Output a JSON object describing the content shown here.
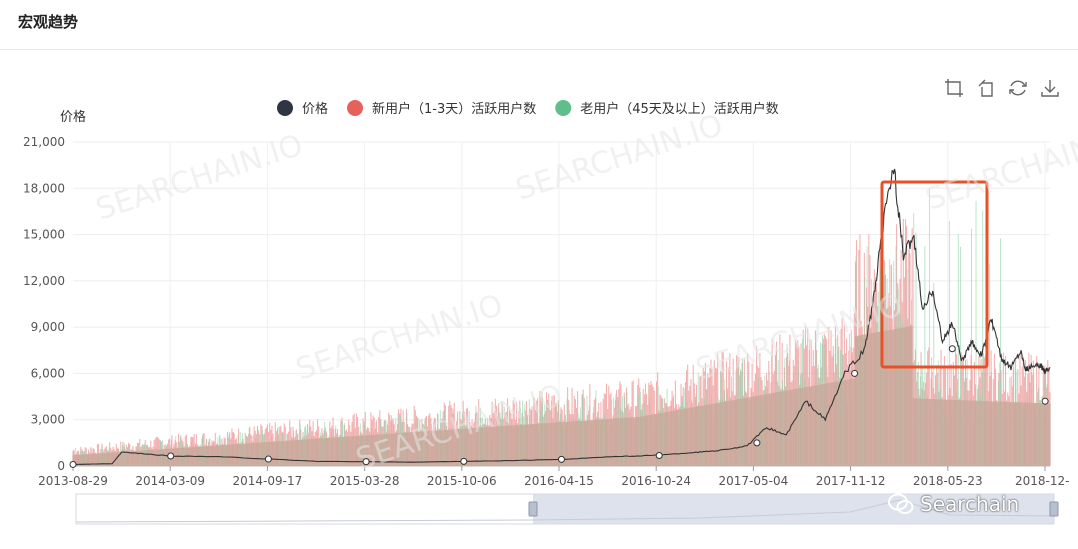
{
  "header": {
    "title": "宏观趋势"
  },
  "toolbar": {
    "buttons": [
      {
        "icon": "zoom-icon"
      },
      {
        "icon": "zoom-reset-icon"
      },
      {
        "icon": "refresh-icon"
      },
      {
        "icon": "download-icon"
      }
    ]
  },
  "brand_watermark": {
    "text": "Searchain"
  },
  "chart_data": {
    "type": "line",
    "ylabel": "价格",
    "ylim": [
      0,
      21000
    ],
    "yticks": [
      "0",
      "3,000",
      "6,000",
      "9,000",
      "12,000",
      "15,000",
      "18,000",
      "21,000"
    ],
    "xtick_labels": [
      "2013-08-29",
      "2014-03-09",
      "2014-09-17",
      "2015-03-28",
      "2015-10-06",
      "2016-04-15",
      "2016-10-24",
      "2017-05-04",
      "2017-11-12",
      "2018-05-23",
      "2018-12-"
    ],
    "legend_position": "top-center",
    "grid": true,
    "legend": [
      {
        "name": "价格",
        "color": "#2f3542"
      },
      {
        "name": "新用户（1-3天）活跃用户数",
        "color": "#e8605a"
      },
      {
        "name": "老用户（45天及以上）活跃用户数",
        "color": "#5fbf8a"
      }
    ],
    "series": [
      {
        "name": "价格",
        "type": "line",
        "color": "#333333",
        "points": [
          [
            0,
            100
          ],
          [
            0.04,
            150
          ],
          [
            0.05,
            900
          ],
          [
            0.07,
            800
          ],
          [
            0.1,
            650
          ],
          [
            0.15,
            600
          ],
          [
            0.2,
            450
          ],
          [
            0.25,
            300
          ],
          [
            0.3,
            280
          ],
          [
            0.35,
            250
          ],
          [
            0.4,
            300
          ],
          [
            0.45,
            350
          ],
          [
            0.5,
            430
          ],
          [
            0.55,
            600
          ],
          [
            0.58,
            650
          ],
          [
            0.61,
            750
          ],
          [
            0.64,
            900
          ],
          [
            0.66,
            1000
          ],
          [
            0.69,
            1300
          ],
          [
            0.71,
            2500
          ],
          [
            0.73,
            2000
          ],
          [
            0.75,
            4200
          ],
          [
            0.77,
            3000
          ],
          [
            0.79,
            6000
          ],
          [
            0.81,
            7500
          ],
          [
            0.82,
            11000
          ],
          [
            0.83,
            16000
          ],
          [
            0.84,
            19500
          ],
          [
            0.85,
            13500
          ],
          [
            0.86,
            15000
          ],
          [
            0.87,
            10000
          ],
          [
            0.88,
            11500
          ],
          [
            0.89,
            8000
          ],
          [
            0.9,
            9300
          ],
          [
            0.91,
            6800
          ],
          [
            0.92,
            8000
          ],
          [
            0.93,
            7200
          ],
          [
            0.94,
            9500
          ],
          [
            0.95,
            7000
          ],
          [
            0.96,
            6400
          ],
          [
            0.97,
            7500
          ],
          [
            0.975,
            6300
          ],
          [
            0.98,
            6400
          ],
          [
            0.99,
            6500
          ],
          [
            0.995,
            6200
          ],
          [
            1.0,
            6400
          ]
        ]
      },
      {
        "name": "新用户（1-3天）活跃用户数",
        "type": "bar-envelope",
        "color": "#f0a0a0"
      },
      {
        "name": "老用户（45天及以上）活跃用户数",
        "type": "bar-envelope",
        "color": "#8fd4ad"
      }
    ],
    "annotations": [
      {
        "type": "highlight-box",
        "color": "#e8502a"
      }
    ],
    "watermark_text": "SEARCHAIN.IO"
  }
}
